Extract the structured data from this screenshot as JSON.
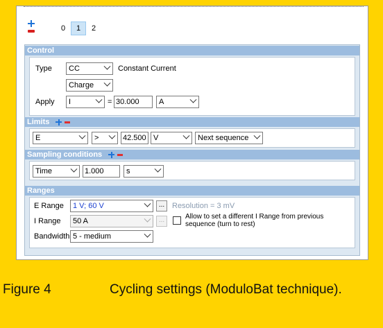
{
  "sequences": {
    "tabs": [
      "0",
      "1",
      "2"
    ],
    "active": "1"
  },
  "control": {
    "header": "Control",
    "type_label": "Type",
    "type_value": "CC",
    "type_description": "Constant Current",
    "mode_value": "Charge",
    "apply_label": "Apply",
    "apply_variable": "I",
    "apply_equals": "=",
    "apply_value": "30.000",
    "apply_unit": "A"
  },
  "limits": {
    "header": "Limits",
    "variable": "E",
    "operator": ">",
    "value": "42.500",
    "unit": "V",
    "action": "Next sequence"
  },
  "sampling": {
    "header": "Sampling conditions",
    "variable": "Time",
    "value": "1.000",
    "unit": "s"
  },
  "ranges": {
    "header": "Ranges",
    "e_range_label": "E Range",
    "e_range_value": "1 V; 60 V",
    "ellipsis_label": "...",
    "resolution": "Resolution = 3 mV",
    "i_range_label": "I Range",
    "i_range_value": "50 A",
    "allow_text": "Allow to set a different I Range from previous sequence (turn to rest)",
    "bandwidth_label": "Bandwidth",
    "bandwidth_value": "5 - medium"
  },
  "caption": {
    "number": "Figure 4",
    "text": "Cycling settings (ModuloBat technique)."
  },
  "colors": {
    "background": "#FFD300",
    "section_header": "#9cbcdf",
    "panel": "#dde8f2",
    "active_tab": "#cce4f7",
    "add_icon": "#1e73d8",
    "remove_icon": "#d8201f"
  }
}
